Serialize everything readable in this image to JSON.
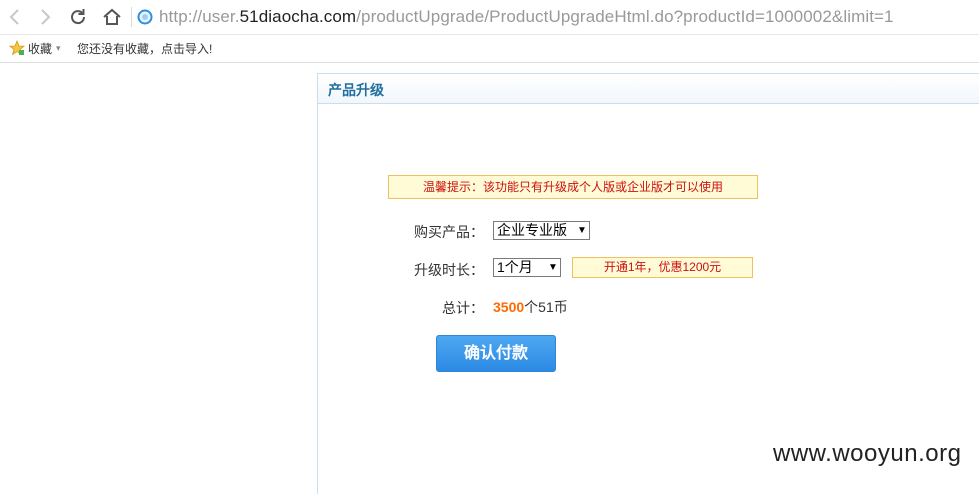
{
  "browser": {
    "url_prefix": "http://user.",
    "url_host": "51diaocha.com",
    "url_path": "/productUpgrade/ProductUpgradeHtml.do?productId=1000002&limit=1",
    "bookmarks_label": "收藏",
    "bookmarks_hint": "您还没有收藏，点击导入!"
  },
  "panel": {
    "title": "产品升级"
  },
  "notice": {
    "text": "温馨提示：该功能只有升级成个人版或企业版才可以使用"
  },
  "form": {
    "product_label": "购买产品：",
    "product_value": "企业专业版",
    "duration_label": "升级时长：",
    "duration_value": "1个月",
    "promo_text": "开通1年，优惠1200元",
    "total_label": "总计：",
    "total_amount": "3500",
    "total_unit": "个51币",
    "confirm_label": "确认付款"
  },
  "watermark": {
    "text": "www.wooyun.org"
  },
  "colors": {
    "accent": "#2b8ae3",
    "title": "#1f6e9e",
    "notice_text": "#cc1010",
    "amount": "#ff6a00"
  }
}
